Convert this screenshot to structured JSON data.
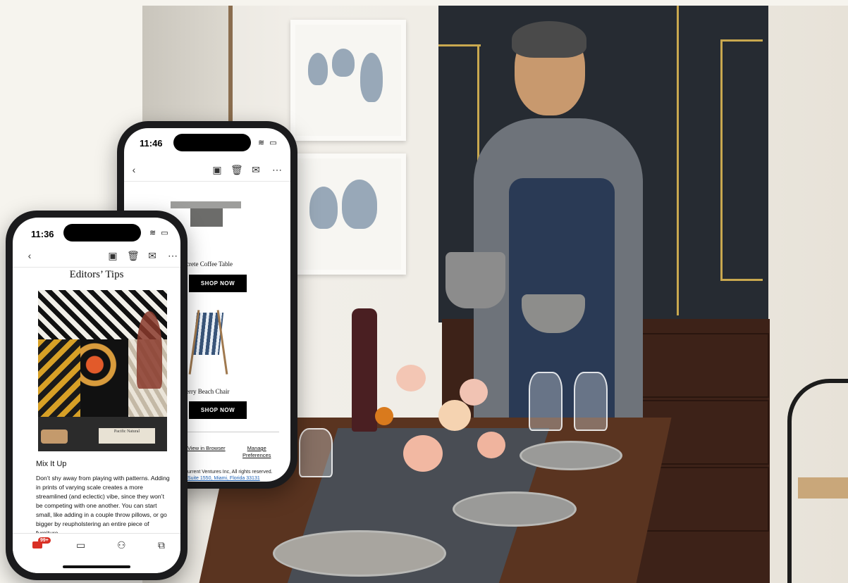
{
  "colors": {
    "accent": "#d93025",
    "button_bg": "#000000",
    "link": "#1a5fb4"
  },
  "phone_back": {
    "time": "11:46",
    "toolbar": {
      "back_icon": "chevron-left-icon",
      "archive_icon": "archive-icon",
      "delete_icon": "trash-icon",
      "mark_icon": "mail-icon",
      "more_icon": "more-icon"
    },
    "products": [
      {
        "name": "crete Coffee Table",
        "button": "SHOP NOW"
      },
      {
        "name": "erry Beach Chair",
        "button": "SHOP NOW"
      }
    ],
    "footer": {
      "view_in_browser": "View in Browser",
      "manage_line1": "Manage",
      "manage_line2": "Preferences",
      "copyright": "urrent Ventures Inc, All rights reserved.",
      "address": "Suite 1550, Miami, Florida 33131"
    }
  },
  "phone_front": {
    "time": "11:36",
    "title": "Editors’ Tips",
    "section_heading": "Mix It Up",
    "body_lines": [
      "Don’t shy away from playing with patterns. Adding",
      "in prints of varying scale creates a more",
      "streamlined (and eclectic) vibe, since they won’t",
      "be competing with one another. You can start",
      "small, like adding in a couple throw pillows, or go",
      "bigger by reupholstering an entire piece of",
      "furniture."
    ],
    "book_label": "Pacific Natural",
    "tabs": {
      "mail_badge": "99+"
    }
  }
}
